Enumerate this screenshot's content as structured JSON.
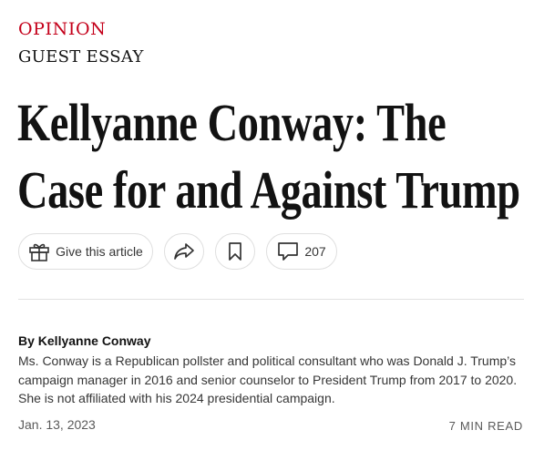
{
  "section": "OPINION",
  "kicker": "GUEST ESSAY",
  "headline_line1": "Kellyanne Conway: The",
  "headline_line2": "Case for and Against Trump",
  "actions": {
    "gift_label": "Give this article",
    "comment_count": "207",
    "icons": [
      "gift-icon",
      "share-icon",
      "bookmark-icon",
      "comment-icon"
    ]
  },
  "byline": "By Kellyanne Conway",
  "bio": "Ms. Conway is a Republican pollster and political consultant who was Donald J. Trump’s campaign manager in 2016 and senior counselor to President Trump from 2017 to 2020. She is not affiliated with his 2024 presidential campaign.",
  "date": "Jan. 13, 2023",
  "read_time": "7 MIN READ",
  "colors": {
    "section_red": "#c4001a",
    "text": "#121212",
    "muted": "#5a5a5a"
  }
}
